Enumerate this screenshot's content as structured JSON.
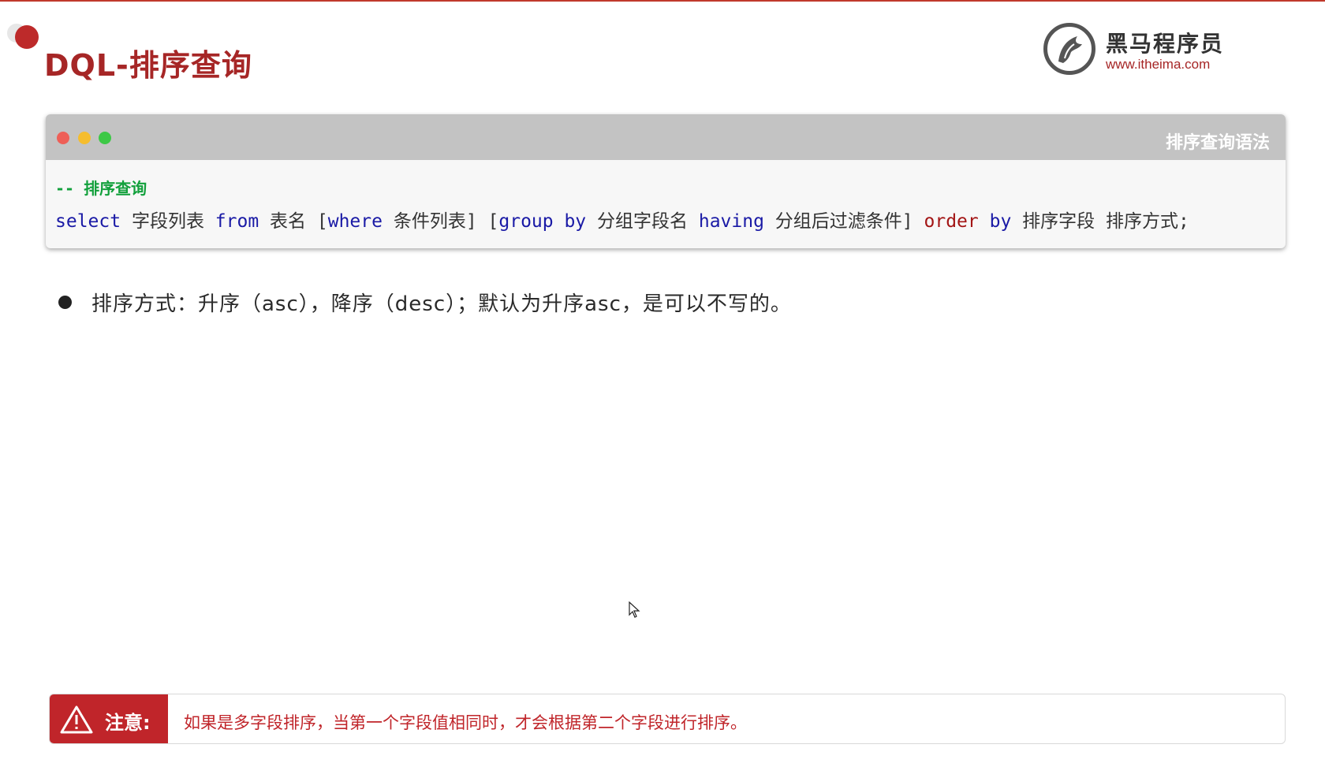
{
  "header": {
    "title": "DQL-排序查询"
  },
  "logo": {
    "name": "黑马程序员",
    "url": "www.itheima.com",
    "icon": "horse-logo-icon"
  },
  "code_window": {
    "title": "排序查询语法",
    "comment": "-- 排序查询",
    "tokens": [
      {
        "text": "select",
        "kind": "keyword"
      },
      {
        "text": " 字段列表 ",
        "kind": "text"
      },
      {
        "text": "from",
        "kind": "keyword"
      },
      {
        "text": " 表名 [",
        "kind": "text"
      },
      {
        "text": "where",
        "kind": "keyword"
      },
      {
        "text": " 条件列表] [",
        "kind": "text"
      },
      {
        "text": "group by",
        "kind": "keyword"
      },
      {
        "text": " 分组字段名 ",
        "kind": "text"
      },
      {
        "text": "having",
        "kind": "keyword"
      },
      {
        "text": " 分组后过滤条件] ",
        "kind": "text"
      },
      {
        "text": "order",
        "kind": "keyword-red"
      },
      {
        "text": " ",
        "kind": "text"
      },
      {
        "text": "by",
        "kind": "keyword"
      },
      {
        "text": " 排序字段 排序方式;",
        "kind": "text"
      }
    ]
  },
  "bullets": [
    "排序方式：升序（asc），降序（desc）；默认为升序asc，是可以不写的。"
  ],
  "note": {
    "label": "注意:",
    "icon": "warning-icon",
    "text": "如果是多字段排序，当第一个字段值相同时，才会根据第二个字段进行排序。"
  },
  "colors": {
    "accent": "#a62626",
    "note_red": "#c0252a",
    "comment_green": "#12a03c",
    "keyword_blue": "#1a1aa6"
  }
}
